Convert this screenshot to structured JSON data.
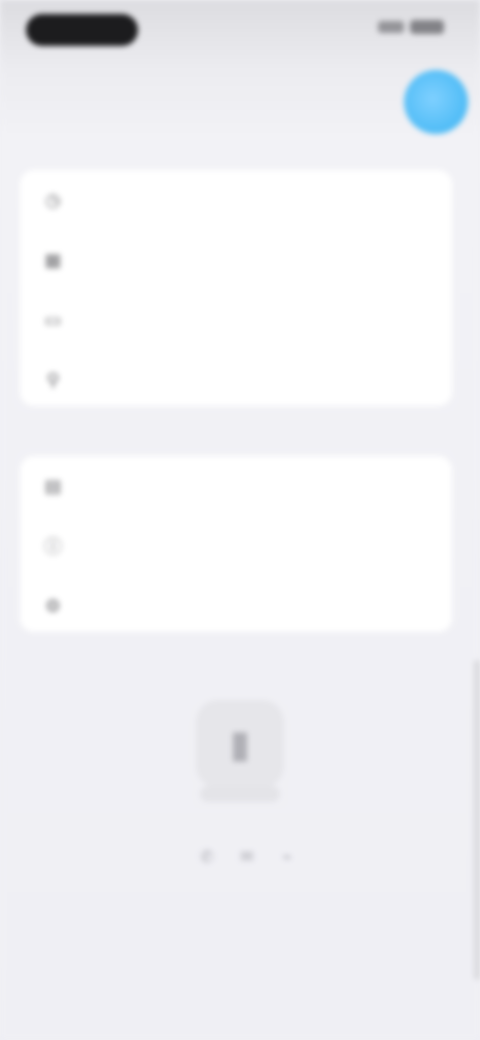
{
  "status_bar": {
    "time": ""
  },
  "nav": {
    "title": "",
    "avatar_initial": ""
  },
  "menu_main": [
    {
      "icon": "clock-icon",
      "label": ""
    },
    {
      "icon": "grid-icon",
      "label": ""
    },
    {
      "icon": "bookmark-icon",
      "label": ""
    },
    {
      "icon": "user-icon",
      "label": ""
    }
  ],
  "menu_more": [
    {
      "icon": "document-icon",
      "label": ""
    },
    {
      "icon": "info-icon",
      "label": ""
    },
    {
      "icon": "settings-icon",
      "label": ""
    }
  ],
  "footer": {
    "logo_icon": "app-logo-icon",
    "link_text": "",
    "social": [
      "share-icon",
      "message-icon",
      "link-icon"
    ]
  },
  "colors": {
    "accent": "#3ab3f2",
    "background": "#efeff4",
    "card": "#ffffff"
  }
}
